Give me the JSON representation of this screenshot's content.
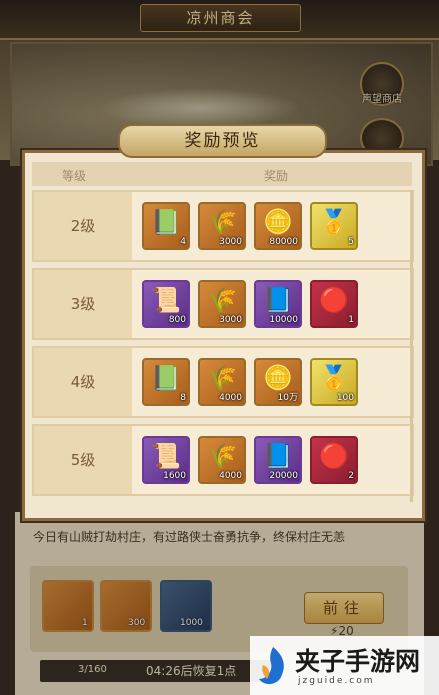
{
  "window": {
    "title": "凉州商会"
  },
  "shop": {
    "label": "声望商店"
  },
  "story": "今日有山贼打劫村庄，有过路侠士奋勇抗争，终保村庄无恙",
  "lower_items": [
    {
      "icon": "green-book-icon",
      "count": "1"
    },
    {
      "icon": "coin-pile-icon",
      "count": "300"
    },
    {
      "icon": "jade-book-icon",
      "count": "1000"
    }
  ],
  "go_button": {
    "label": "前往",
    "cost": "20"
  },
  "progress": {
    "text": "3/160",
    "value": 0.01875
  },
  "timer": "04:26后恢复1点",
  "watermark": {
    "brand": "夹子手游网",
    "url": "jzguide.com"
  },
  "modal": {
    "title": "奖励预览",
    "headers": {
      "level": "等级",
      "reward": "奖励"
    },
    "rows": [
      {
        "level": "2级",
        "items": [
          {
            "icon": "green-book-icon",
            "count": "4",
            "rarity": "orange"
          },
          {
            "icon": "wheat-icon",
            "count": "3000",
            "rarity": "orange"
          },
          {
            "icon": "coin-icon",
            "count": "80000",
            "rarity": "orange"
          },
          {
            "icon": "gold-ingot-icon",
            "count": "5",
            "rarity": "gold"
          }
        ]
      },
      {
        "level": "3级",
        "items": [
          {
            "icon": "scroll-icon",
            "count": "800",
            "rarity": "purple"
          },
          {
            "icon": "wheat-icon",
            "count": "3000",
            "rarity": "orange"
          },
          {
            "icon": "jade-book-icon",
            "count": "10000",
            "rarity": "purple"
          },
          {
            "icon": "token-icon",
            "count": "1",
            "rarity": "red"
          }
        ]
      },
      {
        "level": "4级",
        "items": [
          {
            "icon": "green-book-icon",
            "count": "8",
            "rarity": "orange"
          },
          {
            "icon": "wheat-icon",
            "count": "4000",
            "rarity": "orange"
          },
          {
            "icon": "coin-icon",
            "count": "10万",
            "rarity": "orange"
          },
          {
            "icon": "gold-ingot-icon",
            "count": "100",
            "rarity": "gold"
          }
        ]
      },
      {
        "level": "5级",
        "items": [
          {
            "icon": "scroll-icon",
            "count": "1600",
            "rarity": "purple"
          },
          {
            "icon": "wheat-icon",
            "count": "4000",
            "rarity": "orange"
          },
          {
            "icon": "jade-book-icon",
            "count": "20000",
            "rarity": "purple"
          },
          {
            "icon": "token-icon",
            "count": "2",
            "rarity": "red"
          }
        ]
      }
    ]
  }
}
